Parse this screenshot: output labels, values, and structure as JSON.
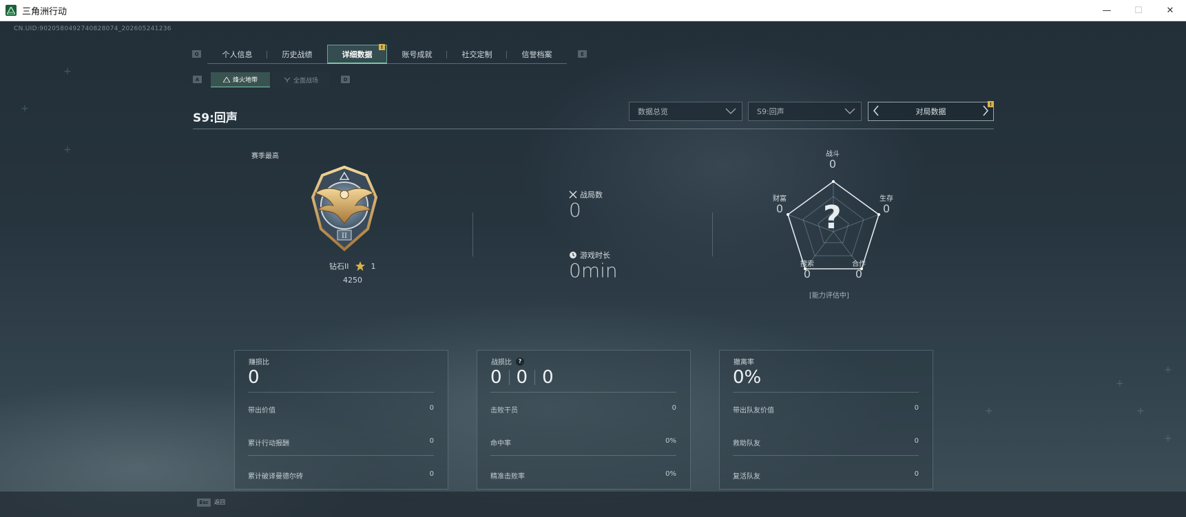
{
  "window": {
    "title": "三角洲行动",
    "minimize": "—",
    "maximize": "☐",
    "close": "✕"
  },
  "uid": "CN.UID:9020580492740828074_202605241236",
  "tabs": {
    "left_key": "Q",
    "right_key": "E",
    "items": [
      {
        "label": "个人信息"
      },
      {
        "label": "历史战绩"
      },
      {
        "label": "详细数据",
        "active": true,
        "badge": "!"
      },
      {
        "label": "账号成就"
      },
      {
        "label": "社交定制"
      },
      {
        "label": "信誉档案"
      }
    ]
  },
  "subtabs": {
    "left_key": "A",
    "right_key": "D",
    "items": [
      {
        "label": "烽火地带",
        "active": true
      },
      {
        "label": "全面战场"
      }
    ]
  },
  "header": {
    "season": "S9:回声",
    "select1": "数据总览",
    "select2": "S9:回声",
    "nav_label": "对局数据",
    "nav_badge": "!"
  },
  "rank": {
    "season_best_label": "赛季最高",
    "tier": "钻石II",
    "stars": "1",
    "score": "4250"
  },
  "stats": {
    "matches_label": "战局数",
    "matches_value": "0",
    "playtime_label": "游戏时长",
    "playtime_value": "0min"
  },
  "radar": {
    "center_mark": "?",
    "status": "[能力评估中]",
    "axes": [
      {
        "name": "战斗",
        "value": "0"
      },
      {
        "name": "生存",
        "value": "0"
      },
      {
        "name": "合作",
        "value": "0"
      },
      {
        "name": "搜索",
        "value": "0"
      },
      {
        "name": "财富",
        "value": "0"
      }
    ]
  },
  "panels": [
    {
      "title": "赚损比",
      "big": "0",
      "rows": [
        {
          "label": "带出价值",
          "value": "0"
        },
        {
          "label": "累计行动报酬",
          "value": "0"
        },
        {
          "label": "累计破译曼德尔砖",
          "value": "0"
        }
      ]
    },
    {
      "title": "战损比",
      "help": "?",
      "big_trio": [
        "0",
        "0",
        "0"
      ],
      "rows": [
        {
          "label": "击败干员",
          "value": "0"
        },
        {
          "label": "命中率",
          "value": "0%"
        },
        {
          "label": "精准击败率",
          "value": "0%"
        }
      ]
    },
    {
      "title": "撤离率",
      "big": "0%",
      "rows": [
        {
          "label": "带出队友价值",
          "value": "0"
        },
        {
          "label": "救助队友",
          "value": "0"
        },
        {
          "label": "复活队友",
          "value": "0"
        }
      ]
    }
  ],
  "footer": {
    "esc_key": "Esc",
    "esc_label": "返回"
  },
  "colors": {
    "accent": "#7ac7a5",
    "badge": "#d8b34a",
    "gold": "#d8b34a"
  }
}
